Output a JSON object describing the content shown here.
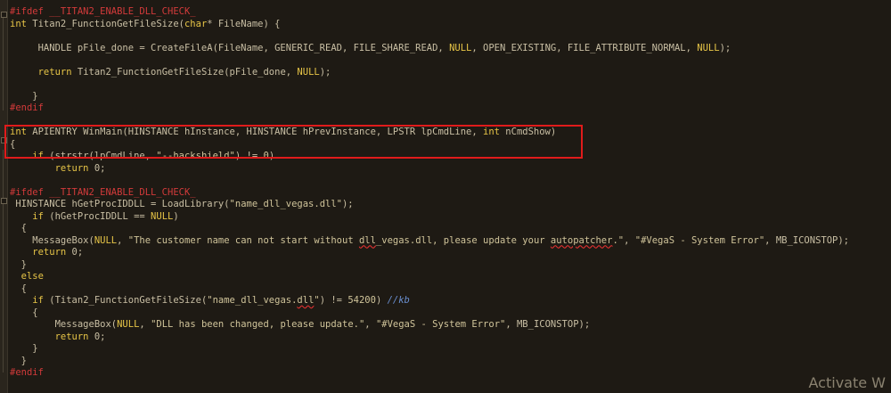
{
  "editor": {
    "lines": [
      [
        {
          "t": "#ifdef __TITAN2_ENABLE_DLL_CHECK_",
          "c": "pp"
        }
      ],
      [
        {
          "t": "int",
          "c": "kw"
        },
        {
          "t": " Titan2_FunctionGetFileSize(",
          "c": "id"
        },
        {
          "t": "char",
          "c": "kw"
        },
        {
          "t": "* FileName) {",
          "c": "id"
        }
      ],
      [
        {
          "t": "",
          "c": "id"
        }
      ],
      [
        {
          "t": "     HANDLE pFile_done = CreateFileA(FileName, GENERIC_READ, FILE_SHARE_READ, ",
          "c": "id"
        },
        {
          "t": "NULL",
          "c": "cst"
        },
        {
          "t": ", OPEN_EXISTING, FILE_ATTRIBUTE_NORMAL, ",
          "c": "id"
        },
        {
          "t": "NULL",
          "c": "cst"
        },
        {
          "t": ");",
          "c": "id"
        }
      ],
      [
        {
          "t": "",
          "c": "id"
        }
      ],
      [
        {
          "t": "     return",
          "c": "kw"
        },
        {
          "t": " Titan2_FunctionGetFileSize(pFile_done, ",
          "c": "id"
        },
        {
          "t": "NULL",
          "c": "cst"
        },
        {
          "t": ");",
          "c": "id"
        }
      ],
      [
        {
          "t": "",
          "c": "id"
        }
      ],
      [
        {
          "t": "    }",
          "c": "id"
        }
      ],
      [
        {
          "t": "#endif",
          "c": "pp"
        }
      ],
      [
        {
          "t": "",
          "c": "id"
        }
      ],
      [
        {
          "t": "int",
          "c": "kw"
        },
        {
          "t": " APIENTRY WinMain(HINSTANCE hInstance, HINSTANCE hPrevInstance, LPSTR lpCmdLine, ",
          "c": "id"
        },
        {
          "t": "int",
          "c": "kw"
        },
        {
          "t": " nCmdShow)",
          "c": "id"
        }
      ],
      [
        {
          "t": "{",
          "c": "id"
        }
      ],
      [
        {
          "t": "    if",
          "c": "kw"
        },
        {
          "t": " (strstr(lpCmdLine, ",
          "c": "id"
        },
        {
          "t": "\"--hackshield\"",
          "c": "str"
        },
        {
          "t": ") != ",
          "c": "id"
        },
        {
          "t": "0",
          "c": "num"
        },
        {
          "t": ")",
          "c": "id"
        }
      ],
      [
        {
          "t": "        return",
          "c": "kw"
        },
        {
          "t": " 0;",
          "c": "id"
        }
      ],
      [
        {
          "t": "",
          "c": "id"
        }
      ],
      [
        {
          "t": "#ifdef __TITAN2_ENABLE_DLL_CHECK_",
          "c": "pp"
        }
      ],
      [
        {
          "t": " HINSTANCE hGetProcIDDLL = LoadLibrary(",
          "c": "id"
        },
        {
          "t": "\"name_dll_vegas.dll\"",
          "c": "str"
        },
        {
          "t": ");",
          "c": "id"
        }
      ],
      [
        {
          "t": "    if",
          "c": "kw"
        },
        {
          "t": " (hGetProcIDDLL == ",
          "c": "id"
        },
        {
          "t": "NULL",
          "c": "cst"
        },
        {
          "t": ")",
          "c": "id"
        }
      ],
      [
        {
          "t": "  {",
          "c": "id"
        }
      ],
      [
        {
          "t": "    MessageBox(",
          "c": "id"
        },
        {
          "t": "NULL",
          "c": "cst"
        },
        {
          "t": ", ",
          "c": "id"
        },
        {
          "t": "\"The customer name can not start without ",
          "c": "str"
        },
        {
          "t": "dll",
          "c": "str squig"
        },
        {
          "t": "_vegas.dll, please update your ",
          "c": "str"
        },
        {
          "t": "autopatcher",
          "c": "str squig"
        },
        {
          "t": ".\"",
          "c": "str"
        },
        {
          "t": ", ",
          "c": "id"
        },
        {
          "t": "\"#VegaS - System Error\"",
          "c": "str"
        },
        {
          "t": ", MB_ICONSTOP);",
          "c": "id"
        }
      ],
      [
        {
          "t": "    return",
          "c": "kw"
        },
        {
          "t": " 0;",
          "c": "id"
        }
      ],
      [
        {
          "t": "  }",
          "c": "id"
        }
      ],
      [
        {
          "t": "  else",
          "c": "kw"
        }
      ],
      [
        {
          "t": "  {",
          "c": "id"
        }
      ],
      [
        {
          "t": "    if",
          "c": "kw"
        },
        {
          "t": " (Titan2_FunctionGetFileSize(",
          "c": "id"
        },
        {
          "t": "\"name_dll_vegas.",
          "c": "str"
        },
        {
          "t": "dll",
          "c": "str squig"
        },
        {
          "t": "\"",
          "c": "str"
        },
        {
          "t": ") != ",
          "c": "id"
        },
        {
          "t": "54200",
          "c": "num"
        },
        {
          "t": ") ",
          "c": "id"
        },
        {
          "t": "//kb",
          "c": "cm"
        }
      ],
      [
        {
          "t": "    {",
          "c": "id"
        }
      ],
      [
        {
          "t": "        MessageBox(",
          "c": "id"
        },
        {
          "t": "NULL",
          "c": "cst"
        },
        {
          "t": ", ",
          "c": "id"
        },
        {
          "t": "\"DLL has been changed, please update.\"",
          "c": "str"
        },
        {
          "t": ", ",
          "c": "id"
        },
        {
          "t": "\"#VegaS - System Error\"",
          "c": "str"
        },
        {
          "t": ", MB_ICONSTOP);",
          "c": "id"
        }
      ],
      [
        {
          "t": "        return",
          "c": "kw"
        },
        {
          "t": " 0;",
          "c": "id"
        }
      ],
      [
        {
          "t": "    }",
          "c": "id"
        }
      ],
      [
        {
          "t": "  }",
          "c": "id"
        }
      ],
      [
        {
          "t": "#endif",
          "c": "pp"
        }
      ]
    ]
  },
  "watermark": {
    "text": "Activate W"
  },
  "colors": {
    "background": "#1e1a14",
    "preprocessor": "#d23a3a",
    "keyword": "#e7c547",
    "text": "#c9bfa4",
    "comment": "#6a8fd0",
    "highlight_border": "#e01b1b"
  }
}
